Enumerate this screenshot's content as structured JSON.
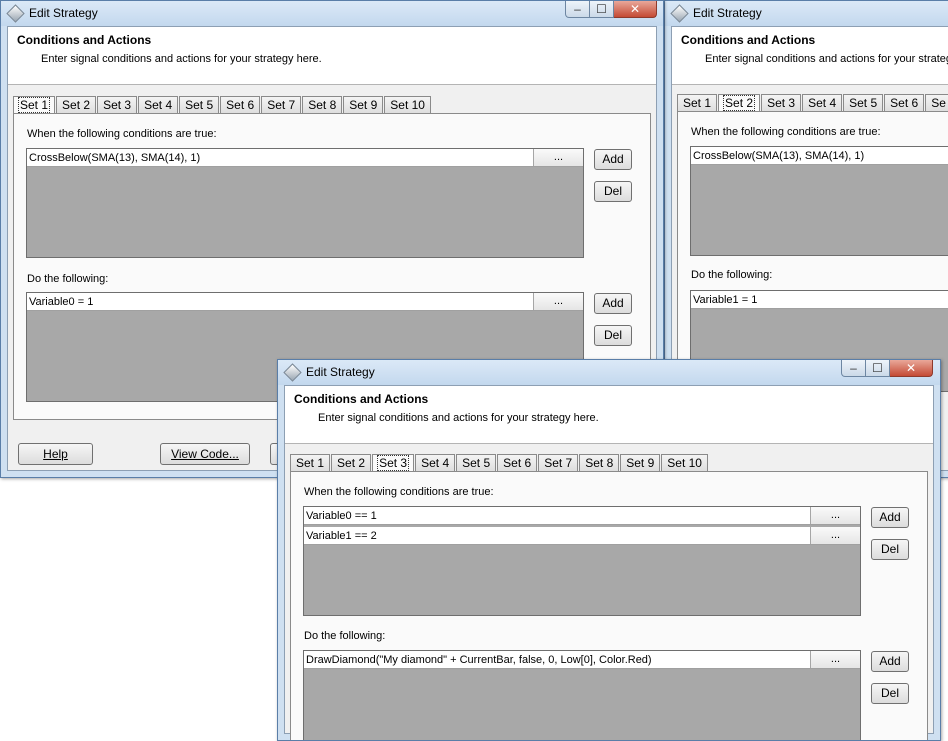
{
  "window_controls": {
    "minimize": "–",
    "maximize": "☐",
    "close": "✕"
  },
  "win1": {
    "title": "Edit Strategy",
    "header_title": "Conditions and Actions",
    "header_sub": "Enter signal conditions and actions for your strategy here.",
    "tabs": [
      "Set 1",
      "Set 2",
      "Set 3",
      "Set 4",
      "Set 5",
      "Set 6",
      "Set 7",
      "Set 8",
      "Set 9",
      "Set 10"
    ],
    "conditions_label": "When the following conditions are true:",
    "conditions": [
      "CrossBelow(SMA(13), SMA(14), 1)"
    ],
    "actions_label": "Do the following:",
    "actions": [
      "Variable0 = 1"
    ],
    "ellipsis": "...",
    "add": "Add",
    "del": "Del",
    "help": "Help",
    "view_code": "View Code..."
  },
  "win2": {
    "title": "Edit Strategy",
    "header_title": "Conditions and Actions",
    "header_sub": "Enter signal conditions and actions for your strategy here.",
    "tabs": [
      "Set 1",
      "Set 2",
      "Set 3",
      "Set 4",
      "Set 5",
      "Set 6",
      "Se"
    ],
    "conditions_label": "When the following conditions are true:",
    "conditions": [
      "CrossBelow(SMA(13), SMA(14), 1)"
    ],
    "actions_label": "Do the following:",
    "actions": [
      "Variable1 = 1"
    ]
  },
  "win3": {
    "title": "Edit Strategy",
    "header_title": "Conditions and Actions",
    "header_sub": "Enter signal conditions and actions for your strategy here.",
    "tabs": [
      "Set 1",
      "Set 2",
      "Set 3",
      "Set 4",
      "Set 5",
      "Set 6",
      "Set 7",
      "Set 8",
      "Set 9",
      "Set 10"
    ],
    "conditions_label": "When the following conditions are true:",
    "conditions": [
      "Variable0 == 1",
      "Variable1 == 2"
    ],
    "actions_label": "Do the following:",
    "actions": [
      "DrawDiamond(\"My diamond\" + CurrentBar, false, 0, Low[0], Color.Red)"
    ],
    "ellipsis": "...",
    "add": "Add",
    "del": "Del"
  }
}
